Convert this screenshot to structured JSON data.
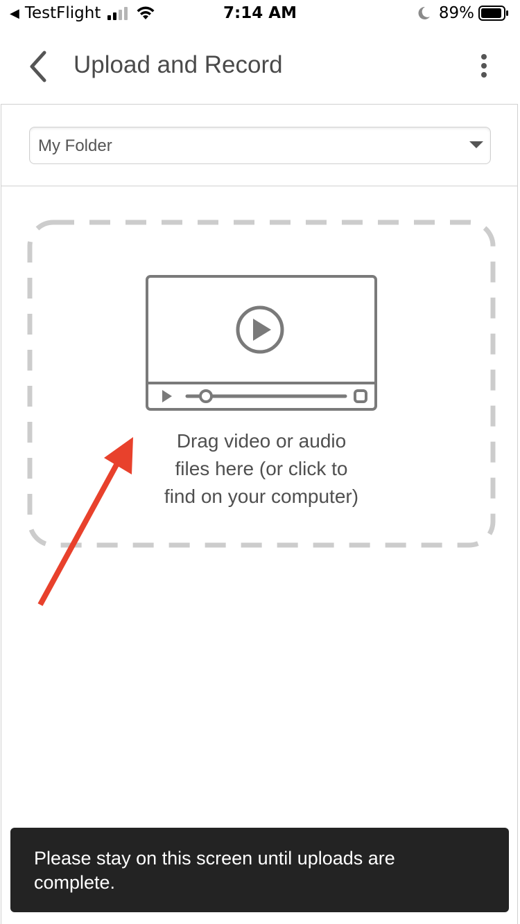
{
  "status_bar": {
    "carrier": "TestFlight",
    "time": "7:14 AM",
    "battery": "89%"
  },
  "header": {
    "title": "Upload and Record"
  },
  "folder": {
    "selected": "My Folder"
  },
  "dropzone": {
    "line1": "Drag video or audio",
    "line2": "files here (or click to",
    "line3": "find on your computer)"
  },
  "toast": {
    "line1": "Please stay on this screen until uploads are",
    "line2": "complete."
  },
  "colors": {
    "annotation_arrow": "#e8412c",
    "toast_bg": "#232323",
    "dash_border": "#cccccc",
    "icon_gray": "#7a7a7a"
  },
  "icons": [
    "back-triangle-icon",
    "cellular-signal-icon",
    "wifi-icon",
    "moon-icon",
    "battery-icon",
    "chevron-left-icon",
    "more-vertical-icon",
    "dropdown-caret-icon",
    "video-player-icon",
    "annotation-arrow"
  ]
}
